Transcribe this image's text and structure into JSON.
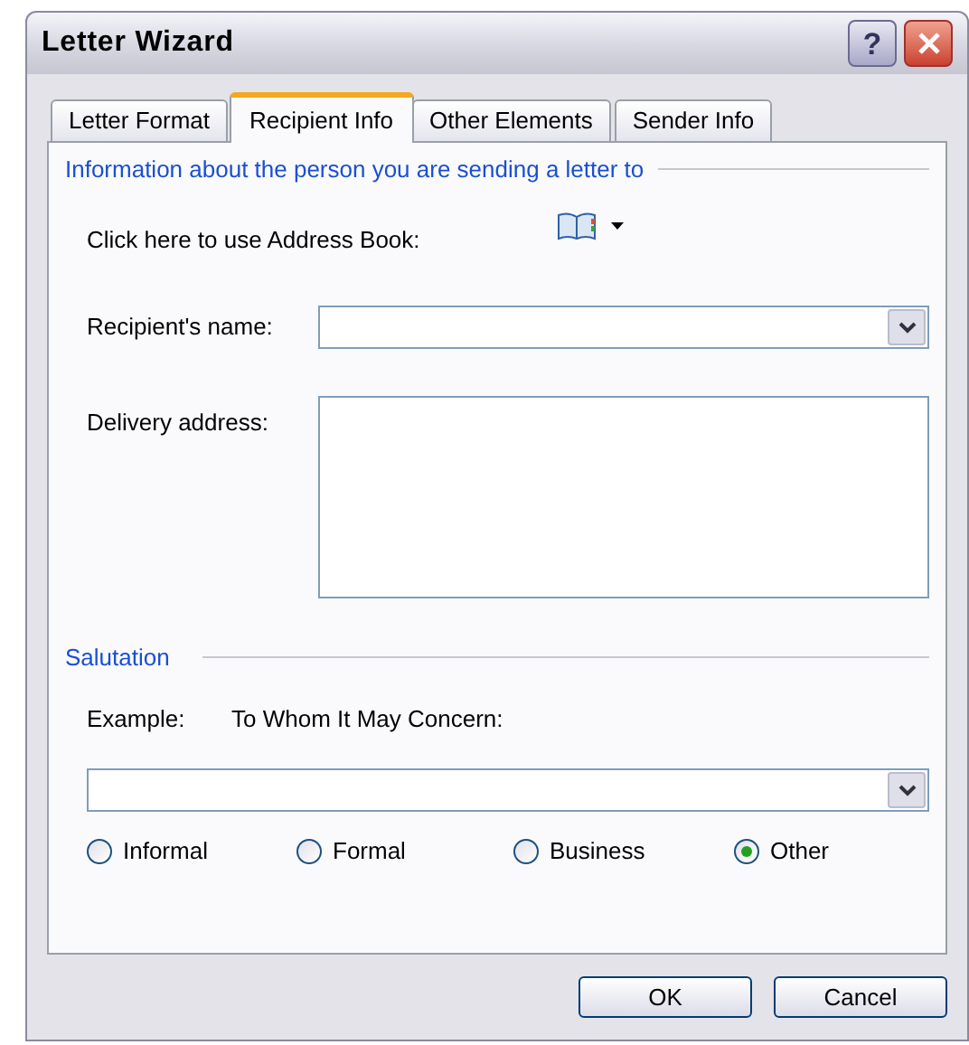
{
  "window": {
    "title": "Letter Wizard",
    "help_button": "?"
  },
  "tabs": [
    {
      "label": "Letter Format",
      "selected": false
    },
    {
      "label": "Recipient Info",
      "selected": true
    },
    {
      "label": "Other Elements",
      "selected": false
    },
    {
      "label": "Sender Info",
      "selected": false
    }
  ],
  "recipient_section": {
    "heading": "Information about the person you are sending a letter to",
    "address_book_label": "Click here to use Address Book:",
    "name_label": "Recipient's name:",
    "address_label": "Delivery address:"
  },
  "salutation": {
    "heading": "Salutation",
    "example_label": "Example:",
    "example_text": "To Whom It May Concern:",
    "options": [
      {
        "label": "Informal",
        "selected": false
      },
      {
        "label": "Formal",
        "selected": false
      },
      {
        "label": "Business",
        "selected": false
      },
      {
        "label": "Other",
        "selected": true
      }
    ]
  },
  "buttons": [
    "OK",
    "Cancel"
  ]
}
